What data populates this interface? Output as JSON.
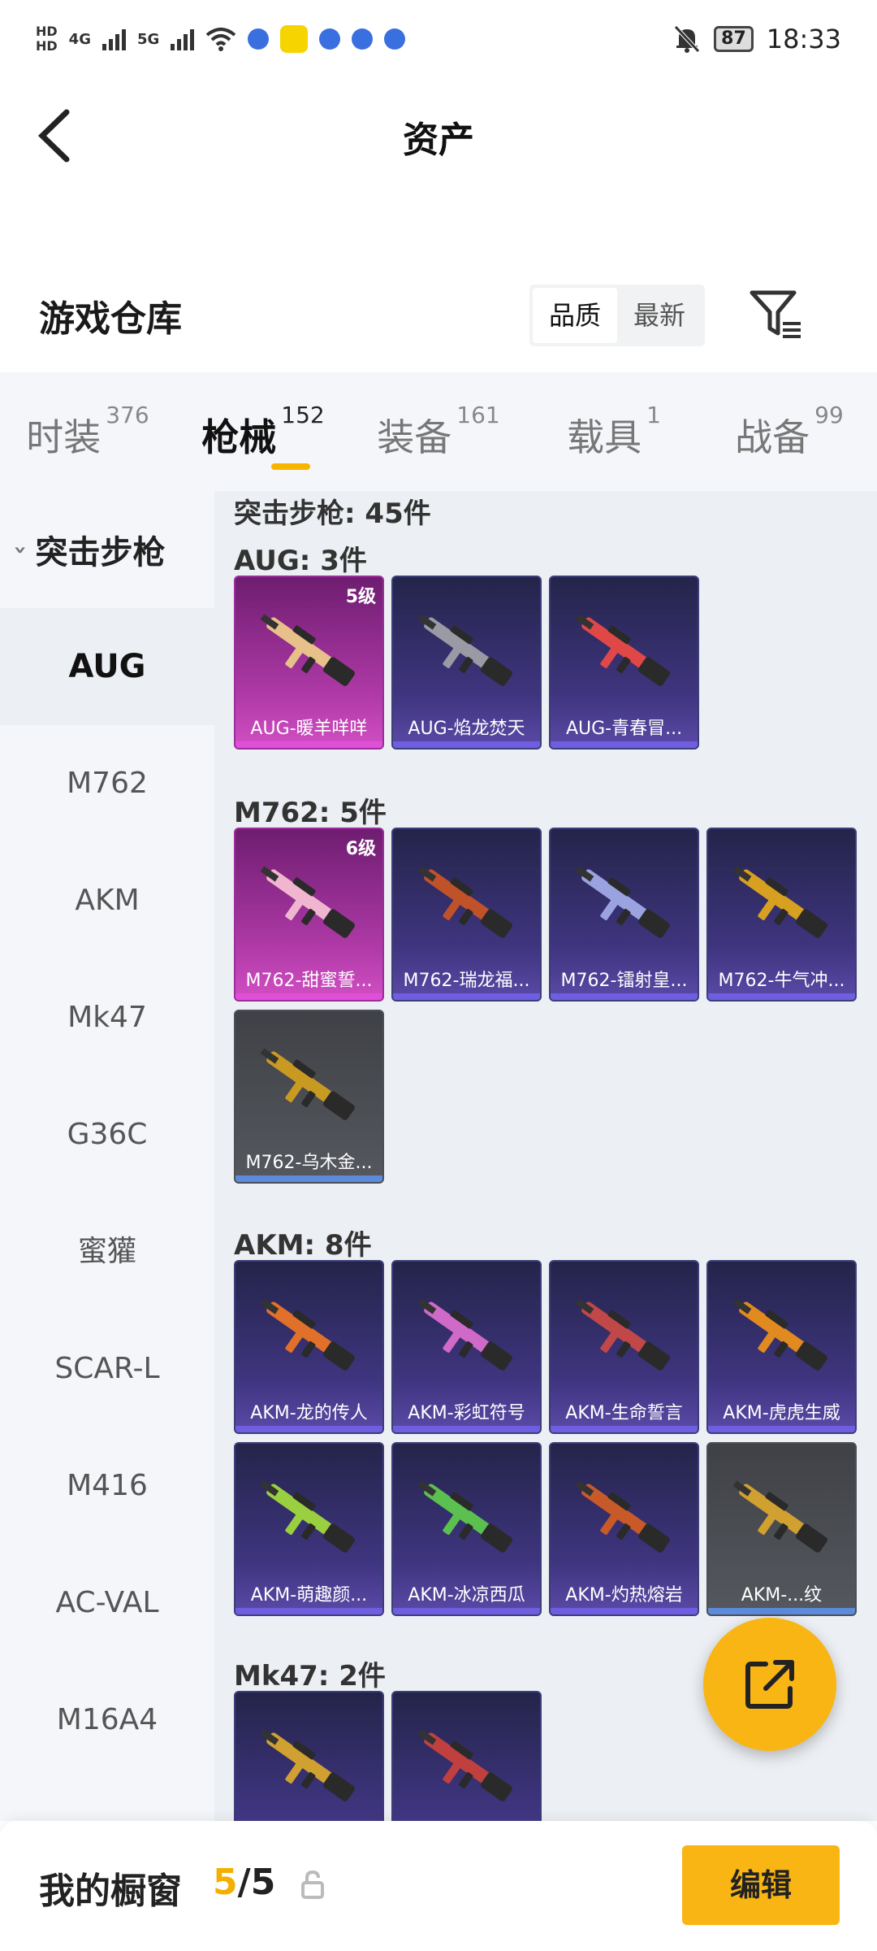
{
  "status_bar": {
    "net1": "HD",
    "net2": "4G",
    "net3": "5G",
    "battery": "87",
    "time": "18:33"
  },
  "header": {
    "title": "资产"
  },
  "warehouse": {
    "title": "游戏仓库",
    "sort_options": [
      "品质",
      "最新"
    ],
    "active_sort": "品质"
  },
  "tabs": [
    {
      "label": "时装",
      "count": "376"
    },
    {
      "label": "枪械",
      "count": "152"
    },
    {
      "label": "装备",
      "count": "161"
    },
    {
      "label": "载具",
      "count": "1"
    },
    {
      "label": "战备",
      "count": "99"
    }
  ],
  "sidebar": {
    "category": "突击步枪",
    "items": [
      "AUG",
      "M762",
      "AKM",
      "Mk47",
      "G36C",
      "蜜獾",
      "SCAR-L",
      "M416",
      "AC-VAL",
      "M16A4"
    ]
  },
  "content": {
    "section_title": "突击步枪: 45件",
    "groups": [
      {
        "title": "AUG: 3件",
        "items": [
          {
            "name": "AUG-暖羊咩咩",
            "grade": "5级",
            "rarity": "pink",
            "color": "#e8c08a"
          },
          {
            "name": "AUG-焰龙焚天",
            "grade": "",
            "rarity": "purple",
            "color": "#9a9aa4"
          },
          {
            "name": "AUG-青春冒...",
            "grade": "",
            "rarity": "purple",
            "color": "#e04848"
          }
        ]
      },
      {
        "title": "M762: 5件",
        "items": [
          {
            "name": "M762-甜蜜誓...",
            "grade": "6级",
            "rarity": "pink",
            "color": "#f0b6d0"
          },
          {
            "name": "M762-瑞龙福...",
            "grade": "",
            "rarity": "purple",
            "color": "#c0522a"
          },
          {
            "name": "M762-镭射皇...",
            "grade": "",
            "rarity": "purple",
            "color": "#9aa2e0"
          },
          {
            "name": "M762-牛气冲...",
            "grade": "",
            "rarity": "purple",
            "color": "#d8a020"
          },
          {
            "name": "M762-乌木金...",
            "grade": "",
            "rarity": "gray",
            "color": "#c99a22"
          }
        ]
      },
      {
        "title": "AKM: 8件",
        "items": [
          {
            "name": "AKM-龙的传人",
            "grade": "",
            "rarity": "purple",
            "color": "#e0702a"
          },
          {
            "name": "AKM-彩虹符号",
            "grade": "",
            "rarity": "purple",
            "color": "#d06ac8"
          },
          {
            "name": "AKM-生命誓言",
            "grade": "",
            "rarity": "purple",
            "color": "#c04848"
          },
          {
            "name": "AKM-虎虎生威",
            "grade": "",
            "rarity": "purple",
            "color": "#e08a20"
          },
          {
            "name": "AKM-萌趣颜...",
            "grade": "",
            "rarity": "purple",
            "color": "#9ad040"
          },
          {
            "name": "AKM-冰凉西瓜",
            "grade": "",
            "rarity": "purple",
            "color": "#5cc050"
          },
          {
            "name": "AKM-灼热熔岩",
            "grade": "",
            "rarity": "purple",
            "color": "#c85a2a"
          },
          {
            "name": "AKM-...纹",
            "grade": "",
            "rarity": "gray",
            "color": "#d0a030"
          }
        ]
      },
      {
        "title": "Mk47: 2件",
        "items": [
          {
            "name": "",
            "grade": "",
            "rarity": "purple",
            "color": "#d0a030"
          },
          {
            "name": "",
            "grade": "",
            "rarity": "purple",
            "color": "#c04040"
          }
        ]
      }
    ]
  },
  "bottom_bar": {
    "label": "我的橱窗",
    "current": "5",
    "separator": "/",
    "total": "5",
    "edit_label": "编辑"
  },
  "colors": {
    "accent": "#f8b514",
    "pink_card": "#b03aa8",
    "purple_card": "#3f3580"
  }
}
